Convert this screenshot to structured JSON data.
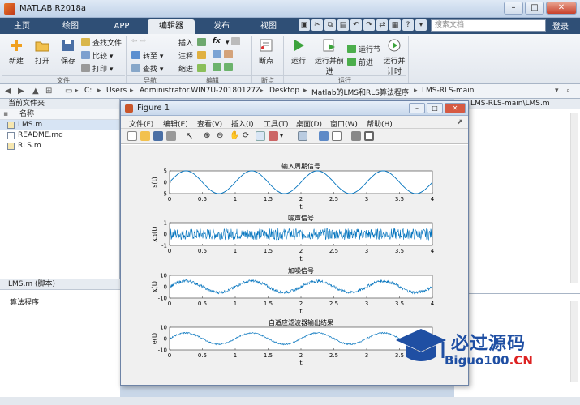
{
  "app": {
    "title": "MATLAB R2018a"
  },
  "tabs": [
    "主页",
    "绘图",
    "APP",
    "编辑器",
    "发布",
    "视图"
  ],
  "active_tab": "编辑器",
  "search": {
    "placeholder": "搜索文档"
  },
  "login": "登录",
  "ribbon": {
    "file": {
      "new": "新建",
      "open": "打开",
      "save": "保存",
      "find_files": "查找文件",
      "compare": "比较",
      "print": "打印",
      "section": "文件"
    },
    "nav": {
      "goto": "转至",
      "find": "查找",
      "section": "导航"
    },
    "edit": {
      "insert": "插入",
      "comment": "注释",
      "indent": "缩进",
      "fx": "fx",
      "section": "编辑"
    },
    "breakpoints": {
      "label": "断点",
      "section": "断点"
    },
    "run": {
      "run": "运行",
      "run_advance": "运行并前进",
      "run_section": "运行节",
      "advance": "前进",
      "run_time": "运行并计时",
      "section": "运行"
    }
  },
  "address": [
    "C:",
    "Users",
    "Administrator.WIN7U-20180127Z",
    "Desktop",
    "Matlab的LMS和RLS算法程序",
    "LMS-RLS-main"
  ],
  "current_folder": {
    "title": "当前文件夹",
    "column": "名称",
    "files": [
      "LMS.m",
      "README.md",
      "RLS.m"
    ],
    "selected": "LMS.m"
  },
  "details": {
    "title": "LMS.m (脚本)",
    "desc": "算法程序"
  },
  "right_path": "LMS-RLS-main\\LMS.m",
  "figure": {
    "title": "Figure 1",
    "menu": [
      "文件(F)",
      "编辑(E)",
      "查看(V)",
      "插入(I)",
      "工具(T)",
      "桌面(D)",
      "窗口(W)",
      "帮助(H)"
    ],
    "plots": [
      {
        "title": "输入周期信号",
        "ylabel": "s(t)",
        "xlabel": "t",
        "yticks": [
          "5",
          "0",
          "-5"
        ]
      },
      {
        "title": "噪声信号",
        "ylabel": "xn(t)",
        "xlabel": "t",
        "yticks": [
          "1",
          "0",
          "-1"
        ]
      },
      {
        "title": "加噪信号",
        "ylabel": "x(t)",
        "xlabel": "t",
        "yticks": [
          "10",
          "0",
          "-10"
        ]
      },
      {
        "title": "自适应滤波器输出结果",
        "ylabel": "e(t)",
        "xlabel": "t",
        "yticks": [
          "10",
          "0",
          "-10"
        ]
      }
    ],
    "xticks": [
      "0",
      "0.5",
      "1",
      "1.5",
      "2",
      "2.5",
      "3",
      "3.5",
      "4"
    ]
  },
  "chart_data": [
    {
      "type": "line",
      "title": "输入周期信号",
      "xlabel": "t",
      "ylabel": "s(t)",
      "xlim": [
        0,
        4
      ],
      "ylim": [
        -5,
        5
      ],
      "series": [
        {
          "values_desc": "sine, amplitude 5, period 1",
          "amplitude": 5,
          "period": 1,
          "noise": 0
        }
      ]
    },
    {
      "type": "line",
      "title": "噪声信号",
      "xlabel": "t",
      "ylabel": "xn(t)",
      "xlim": [
        0,
        4
      ],
      "ylim": [
        -1,
        1
      ],
      "series": [
        {
          "amplitude": 0,
          "period": 1,
          "noise": 0.5
        }
      ]
    },
    {
      "type": "line",
      "title": "加噪信号",
      "xlabel": "t",
      "ylabel": "x(t)",
      "xlim": [
        0,
        4
      ],
      "ylim": [
        -10,
        10
      ],
      "series": [
        {
          "amplitude": 5,
          "period": 1,
          "noise": 1.3
        }
      ]
    },
    {
      "type": "line",
      "title": "自适应滤波器输出结果",
      "xlabel": "t",
      "ylabel": "e(t)",
      "xlim": [
        0,
        4
      ],
      "ylim": [
        -10,
        10
      ],
      "series": [
        {
          "amplitude": 5,
          "period": 1,
          "noise": 0.6
        }
      ]
    }
  ],
  "colors": {
    "line": "#0072bd",
    "tabbar": "#2f4f76"
  },
  "watermark": {
    "line1": "必过源码",
    "line2a": "Biguo100",
    "line2b": ".CN"
  }
}
